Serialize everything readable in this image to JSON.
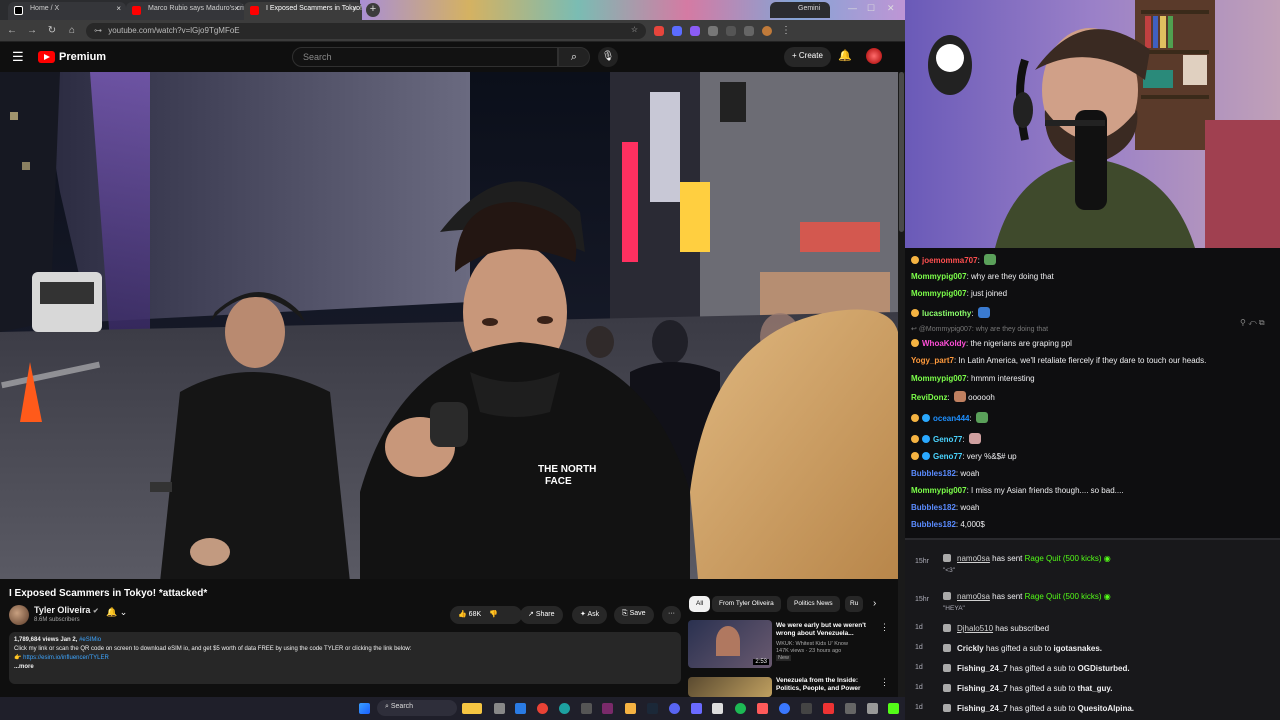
{
  "browser": {
    "tabs": [
      {
        "title": "Home / X",
        "favicon_color": "#ffffff"
      },
      {
        "title": "Marco Rubio says Maduro's cri",
        "favicon_color": "#ff0000"
      },
      {
        "title": "I Exposed Scammers in Tokyo!",
        "favicon_color": "#ff0000"
      }
    ],
    "gemini_tab": "Gemini",
    "url": "youtube.com/watch?v=lGjo9TgMFoE",
    "new_tab": "+"
  },
  "youtube": {
    "logo_text": "Premium",
    "search_placeholder": "Search",
    "create_label": "+ Create",
    "video": {
      "title": "I Exposed Scammers in Tokyo! *attacked*",
      "channel": "Tyler Oliveira",
      "subscribers": "8.6M subscribers",
      "likes": "68K",
      "share_label": "Share",
      "ask_label": "Ask",
      "save_label": "Save",
      "more_label": "···"
    },
    "description": {
      "meta": "1,789,684 views  Jan 2,",
      "hashtag": "#eSIMio",
      "line1": "Click my link or scan the QR code on screen to download eSIM io, and get $5 worth of data FREE by using the code TYLER or clicking the link below:",
      "link": "https://esim.io/influencer/TYLER",
      "more": "...more"
    },
    "chips": [
      "All",
      "From Tyler Oliveira",
      "Politics News",
      "Ru"
    ],
    "recommendations": [
      {
        "title": "We were early but we weren't wrong about Venezuela...",
        "channel": "WKUK: Whitest Kids U' Know",
        "meta": "147K views · 23 hours ago",
        "badge": "New",
        "duration": "2:53"
      },
      {
        "title": "Venezuela from the Inside: Politics, People, and Power",
        "channel": "",
        "meta": "",
        "badge": "",
        "duration": ""
      }
    ]
  },
  "taskbar": {
    "search": "Search"
  },
  "chat": {
    "messages": [
      {
        "user": "joemomma707",
        "color": "#ff4f4f",
        "text": ""
      },
      {
        "user": "Mommypig007",
        "color": "#7cff4a",
        "text": "why are they doing that"
      },
      {
        "user": "Mommypig007",
        "color": "#7cff4a",
        "text": "just joined"
      },
      {
        "user": "lucastimothy",
        "color": "#8cff6c",
        "text": ""
      },
      {
        "user": "@Mommypig007",
        "color": "#8a8a8a",
        "text": "why are they doing that"
      },
      {
        "user": "WhoaKoldy",
        "color": "#ff4fd8",
        "text": "the nigerians are graping ppl"
      },
      {
        "user": "Yogy_part7",
        "color": "#ff9a3c",
        "text": "In Latin America, we'll retaliate fiercely if they dare to touch our heads."
      },
      {
        "user": "Mommypig007",
        "color": "#7cff4a",
        "text": "hmmm interesting"
      },
      {
        "user": "ReviDonz",
        "color": "#7cff4a",
        "text": "oooooh"
      },
      {
        "user": "ocean444",
        "color": "#1e90ff",
        "text": ""
      },
      {
        "user": "Geno77",
        "color": "#4ad4ff",
        "text": ""
      },
      {
        "user": "Geno77",
        "color": "#4ad4ff",
        "text": "very %&$# up"
      },
      {
        "user": "Bubbles182",
        "color": "#5b8cff",
        "text": "woah"
      },
      {
        "user": "Mommypig007",
        "color": "#7cff4a",
        "text": "I miss my Asian friends though.... so bad...."
      },
      {
        "user": "Bubbles182",
        "color": "#5b8cff",
        "text": "woah"
      },
      {
        "user": "Bubbles182",
        "color": "#5b8cff",
        "text": "4,000$"
      }
    ]
  },
  "events": [
    {
      "time": "15hr",
      "user": "namo0sa",
      "action": "has sent",
      "item": "Rage Quit (500 kicks)",
      "quote": "\"<3\""
    },
    {
      "time": "15hr",
      "user": "namo0sa",
      "action": "has sent",
      "item": "Rage Quit (500 kicks)",
      "quote": "\"HEYA\""
    },
    {
      "time": "1d",
      "user": "Djhalo510",
      "action": "has subscribed",
      "item": "",
      "quote": ""
    },
    {
      "time": "1d",
      "user": "Crickly",
      "action": "has gifted a sub to",
      "item": "igotasnakes.",
      "quote": ""
    },
    {
      "time": "1d",
      "user": "Fishing_24_7",
      "action": "has gifted a sub to",
      "item": "OGDisturbed.",
      "quote": ""
    },
    {
      "time": "1d",
      "user": "Fishing_24_7",
      "action": "has gifted a sub to",
      "item": "that_guy.",
      "quote": ""
    },
    {
      "time": "1d",
      "user": "Fishing_24_7",
      "action": "has gifted a sub to",
      "item": "QuesitoAlpina.",
      "quote": ""
    }
  ]
}
